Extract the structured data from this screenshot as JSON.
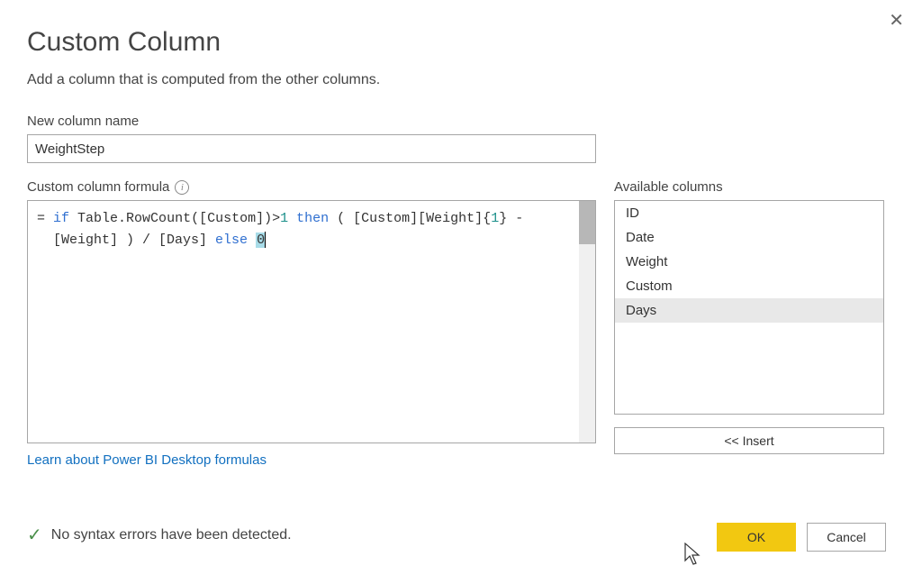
{
  "dialog": {
    "title": "Custom Column",
    "subtitle": "Add a column that is computed from the other columns."
  },
  "name": {
    "label": "New column name",
    "value": "WeightStep"
  },
  "formula": {
    "label": "Custom column formula",
    "tokens": {
      "eq": "= ",
      "if": "if",
      "sp": " ",
      "rowcount": "Table.RowCount([Custom])>",
      "one": "1",
      "then": "then",
      "ob": " ( ",
      "cw1": "[Custom][Weight]{",
      "idx1": "1",
      "cb1": "} -",
      "nl": "\n  ",
      "w": "[Weight] ) / [Days] ",
      "else": "else",
      "zero": "0"
    }
  },
  "link": {
    "label": "Learn about Power BI Desktop formulas"
  },
  "available": {
    "label": "Available columns",
    "items": [
      "ID",
      "Date",
      "Weight",
      "Custom",
      "Days"
    ],
    "selected_index": 4,
    "insert_label": "<< Insert"
  },
  "status": {
    "message": "No syntax errors have been detected."
  },
  "footer": {
    "ok": "OK",
    "cancel": "Cancel"
  }
}
